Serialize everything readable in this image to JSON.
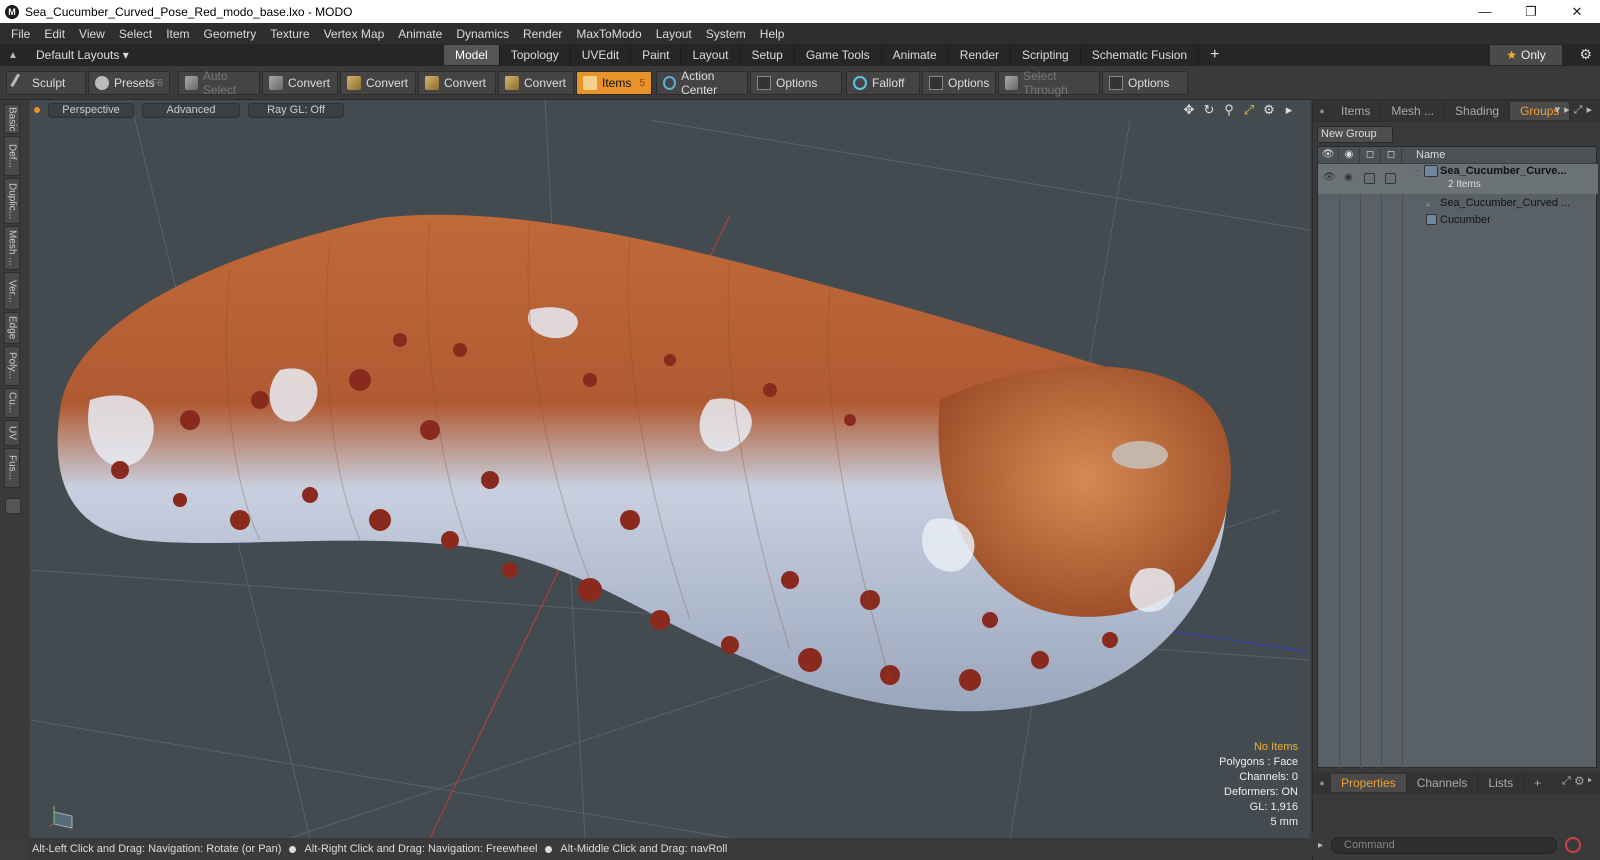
{
  "window": {
    "title": "Sea_Cucumber_Curved_Pose_Red_modo_base.lxo - MODO",
    "controls": [
      "minimize-icon",
      "restore-icon",
      "close-icon"
    ]
  },
  "menu": [
    "File",
    "Edit",
    "View",
    "Select",
    "Item",
    "Geometry",
    "Texture",
    "Vertex Map",
    "Animate",
    "Dynamics",
    "Render",
    "MaxToModo",
    "Layout",
    "System",
    "Help"
  ],
  "layoutbar": {
    "layouts_label": "Default Layouts ▾",
    "tabs": [
      "Model",
      "Topology",
      "UVEdit",
      "Paint",
      "Layout",
      "Setup",
      "Game Tools",
      "Animate",
      "Render",
      "Scripting",
      "Schematic Fusion"
    ],
    "active_tab": "Model",
    "plus": "+",
    "only_label": "Only"
  },
  "toolbar": {
    "sculpt": "Sculpt",
    "presets": "Presets",
    "presets_key": "F6",
    "auto_select": "Auto Select",
    "convert1": "Convert",
    "convert2": "Convert",
    "convert3": "Convert",
    "convert4": "Convert",
    "items": "Items",
    "items_key": "5",
    "action_center": "Action Center",
    "options1": "Options",
    "falloff": "Falloff",
    "options2": "Options",
    "select_through": "Select Through",
    "options3": "Options"
  },
  "left_tabs": [
    "Basic",
    "Def...",
    "Duplic...",
    "Mesh ...",
    "Ver...",
    "Edge",
    "Poly...",
    "Cu...",
    "UV",
    "Fus..."
  ],
  "viewport": {
    "view_mode": "Perspective",
    "advanced": "Advanced",
    "raygl": "Ray GL: Off",
    "stats": {
      "no_items": "No Items",
      "polygons": "Polygons : Face",
      "channels": "Channels: 0",
      "deformers": "Deformers: ON",
      "gl": "GL: 1,916",
      "scale": "5 mm"
    },
    "colors": {
      "background": "#434b50",
      "accent": "#e8922a"
    }
  },
  "right_panel": {
    "tabs": [
      "Items",
      "Mesh ...",
      "Shading",
      "Groups"
    ],
    "active_tab": "Groups",
    "new_group": "New Group",
    "column_name": "Name",
    "rows": [
      {
        "name": "Sea_Cucumber_Curve...",
        "sub": "2 Items"
      },
      {
        "name": "Sea_Cucumber_Curved ..."
      },
      {
        "name": "Cucumber"
      }
    ]
  },
  "properties_panel": {
    "tabs": [
      "Properties",
      "Channels",
      "Lists"
    ],
    "active_tab": "Properties",
    "plus": "+"
  },
  "command": {
    "placeholder": "Command"
  },
  "statusbar": {
    "hint1": "Alt-Left Click and Drag: Navigation: Rotate (or Pan)",
    "hint2": "Alt-Right Click and Drag: Navigation: Freewheel",
    "hint3": "Alt-Middle Click and Drag: navRoll"
  }
}
